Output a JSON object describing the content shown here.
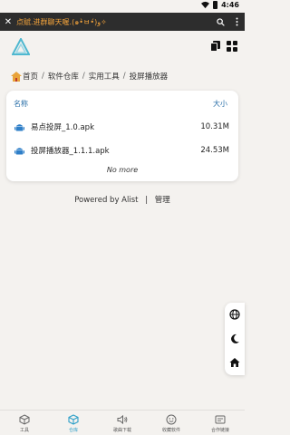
{
  "statusbar": {
    "time": "4:46"
  },
  "topbar": {
    "close_glyph": "✕",
    "title": "点赋.进群聊天喔.(๑•̀ㅂ•́)و✧"
  },
  "breadcrumb": {
    "items": [
      "首页",
      "软件仓库",
      "实用工具",
      "投屏播放器"
    ],
    "separator": "/"
  },
  "table": {
    "headers": {
      "name": "名称",
      "size": "大小"
    },
    "rows": [
      {
        "name": "易点投屏_1.0.apk",
        "size": "10.31M"
      },
      {
        "name": "投屏播放器_1.1.1.apk",
        "size": "24.53M"
      }
    ],
    "end_text": "No more"
  },
  "footer": {
    "powered": "Powered by Alist",
    "separator": "|",
    "admin": "管理"
  },
  "nav": {
    "items": [
      {
        "label": "工具",
        "icon": "tool-icon"
      },
      {
        "label": "仓库",
        "icon": "repository-icon"
      },
      {
        "label": "歌曲下载",
        "icon": "music-download-icon"
      },
      {
        "label": "收藏软件",
        "icon": "favorite-software-icon"
      },
      {
        "label": "合作链接",
        "icon": "cooperation-link-icon"
      }
    ]
  },
  "colors": {
    "accent": "#2fa0c8",
    "title": "#f3a33b",
    "topbar": "#2d2d2d",
    "android": "#2f7fc8"
  }
}
